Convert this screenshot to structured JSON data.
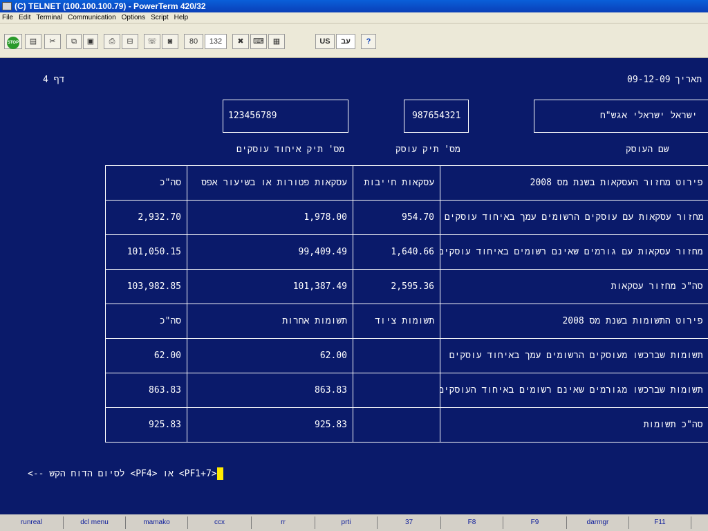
{
  "window": {
    "title": "(C) TELNET (100.100.100.79) - PowerTerm 420/32"
  },
  "menu": [
    "File",
    "Edit",
    "Terminal",
    "Communication",
    "Options",
    "Script",
    "Help"
  ],
  "toolbar": {
    "stop": "STOP",
    "cols80": "80",
    "cols132": "132",
    "lang_us": "US",
    "lang_heb": "עב",
    "help": "?"
  },
  "screen": {
    "page": "דף 4",
    "date_label": "תאריך",
    "date": "09-12-09",
    "business_id": "123456789",
    "business_id_label": "מס' תיק איחוד עוסקים",
    "file_no": "987654321",
    "file_no_label": "מס' תיק עוסק",
    "business_name": "ישראל ישראלי אגש\"ח",
    "business_name_label": "שם העוסק",
    "table": [
      {
        "desc": "פירוט מחזור העסקאות בשנת מס 2008",
        "col1": "עסקאות חייבות",
        "col2": "עסקאות פטורות או בשיעור אפס",
        "col3": "סה\"כ",
        "header": true
      },
      {
        "desc": "מחזור עסקאות עם עוסקים הרשומים עמך באיחוד עוסקים",
        "col1": "954.70",
        "col2": "1,978.00",
        "col3": "2,932.70"
      },
      {
        "desc": "מחזור עסקאות עם גורמים שאינם רשומים באיחוד עוסקים",
        "col1": "1,640.66",
        "col2": "99,409.49",
        "col3": "101,050.15"
      },
      {
        "desc": "סה\"כ מחזור עסקאות",
        "col1": "2,595.36",
        "col2": "101,387.49",
        "col3": "103,982.85"
      },
      {
        "desc": "פירוט התשומות בשנת מס 2008",
        "col1": "תשומות ציוד",
        "col2": "תשומות אחרות",
        "col3": "סה\"כ",
        "header": true
      },
      {
        "desc": "תשומות שברכשו מעוסקים הרשומים עמך באיחוד עוסקים",
        "col1": "",
        "col2": "62.00",
        "col3": "62.00"
      },
      {
        "desc": "תשומות שברכשו מגורמים שאינם רשומים באיחוד העוסקים",
        "col1": "",
        "col2": "863.83",
        "col3": "863.83"
      },
      {
        "desc": "סה\"כ תשומות",
        "col1": "",
        "col2": "925.83",
        "col3": "925.83"
      }
    ],
    "prompt": "<PF1+7> או <PF4> לסיום הדוח הקש -->"
  },
  "statusbar": [
    "runreal",
    "dcl menu",
    "mamako",
    "ccx",
    "rr",
    "prti",
    "37",
    "F8",
    "F9",
    "darmgr",
    "F11"
  ],
  "colors": {
    "screen_bg": "#0a1a6a",
    "text": "#ffffff",
    "cursor": "#ffea00"
  }
}
